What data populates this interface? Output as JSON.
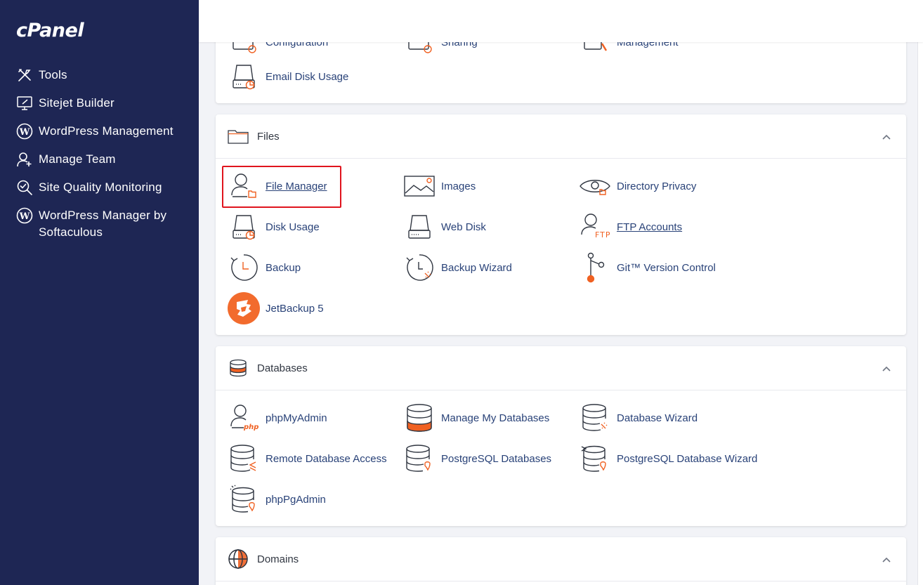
{
  "brand": {
    "logo_text": "cPanel"
  },
  "sidebar": {
    "items": [
      {
        "label": "Tools",
        "icon": "tools-icon"
      },
      {
        "label": "Sitejet Builder",
        "icon": "monitor-brush-icon"
      },
      {
        "label": "WordPress Management",
        "icon": "wordpress-icon"
      },
      {
        "label": "Manage Team",
        "icon": "user-plus-icon"
      },
      {
        "label": "Site Quality Monitoring",
        "icon": "magnifier-check-icon"
      },
      {
        "label": "WordPress Manager by Softaculous",
        "icon": "wordpress-icon"
      }
    ]
  },
  "email_panel": {
    "partial_items": [
      {
        "label": "Configuration",
        "icon": "email-config-icon"
      },
      {
        "label": "Sharing",
        "icon": "calendar-sharing-icon"
      },
      {
        "label": "Management",
        "icon": "filter-management-icon"
      }
    ],
    "items": [
      {
        "label": "Email Disk Usage",
        "icon": "disk-pie-icon"
      }
    ]
  },
  "files_panel": {
    "title": "Files",
    "icon": "folder-icon",
    "items": [
      {
        "label": "File Manager",
        "icon": "file-manager-icon"
      },
      {
        "label": "Images",
        "icon": "image-icon"
      },
      {
        "label": "Directory Privacy",
        "icon": "eye-folder-icon"
      },
      {
        "label": "Disk Usage",
        "icon": "disk-pie-icon"
      },
      {
        "label": "Web Disk",
        "icon": "hard-drive-icon"
      },
      {
        "label": "FTP Accounts",
        "icon": "ftp-user-icon"
      },
      {
        "label": "Backup",
        "icon": "backup-clock-icon"
      },
      {
        "label": "Backup Wizard",
        "icon": "backup-wizard-icon"
      },
      {
        "label": "Git™ Version Control",
        "icon": "git-branch-icon"
      },
      {
        "label": "JetBackup 5",
        "icon": "jetbackup-logo-icon"
      }
    ]
  },
  "databases_panel": {
    "title": "Databases",
    "icon": "database-icon",
    "items": [
      {
        "label": "phpMyAdmin",
        "icon": "php-user-icon"
      },
      {
        "label": "Manage My Databases",
        "icon": "database-orange-icon"
      },
      {
        "label": "Database Wizard",
        "icon": "database-wizard-icon"
      },
      {
        "label": "Remote Database Access",
        "icon": "database-remote-icon"
      },
      {
        "label": "PostgreSQL Databases",
        "icon": "postgresql-database-icon"
      },
      {
        "label": "PostgreSQL Database Wizard",
        "icon": "postgresql-wizard-icon"
      },
      {
        "label": "phpPgAdmin",
        "icon": "phppgadmin-icon"
      }
    ]
  },
  "domains_panel": {
    "title": "Domains",
    "icon": "globe-icon"
  },
  "colors": {
    "sidebar_bg": "#1e2654",
    "link": "#294278",
    "accent": "#f06122",
    "highlight": "#e0141e"
  }
}
